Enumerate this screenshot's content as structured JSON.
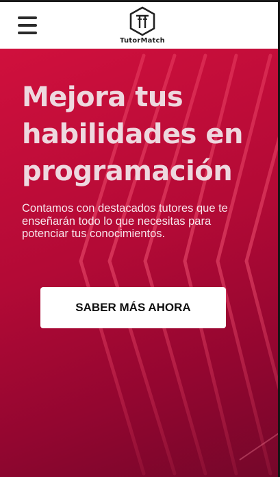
{
  "header": {
    "menu_icon": "hamburger-menu-icon",
    "logo": {
      "icon": "tutormatch-hexagon-logo-icon",
      "text": "TutorMatch"
    }
  },
  "hero": {
    "title": "Mejora tus habilidades en programación",
    "subtitle": "Contamos con destacados tutores que te enseñarán todo lo que necesitas para potenciar tus conocimientos.",
    "cta_label": "SABER MÁS AHORA",
    "background_icon": "chevron-lines-pattern"
  },
  "colors": {
    "hero_primary": "#d0103d",
    "hero_dark": "#74072a",
    "title_text": "#eed8df",
    "cta_background": "#ffffff",
    "cta_text": "#111111"
  }
}
